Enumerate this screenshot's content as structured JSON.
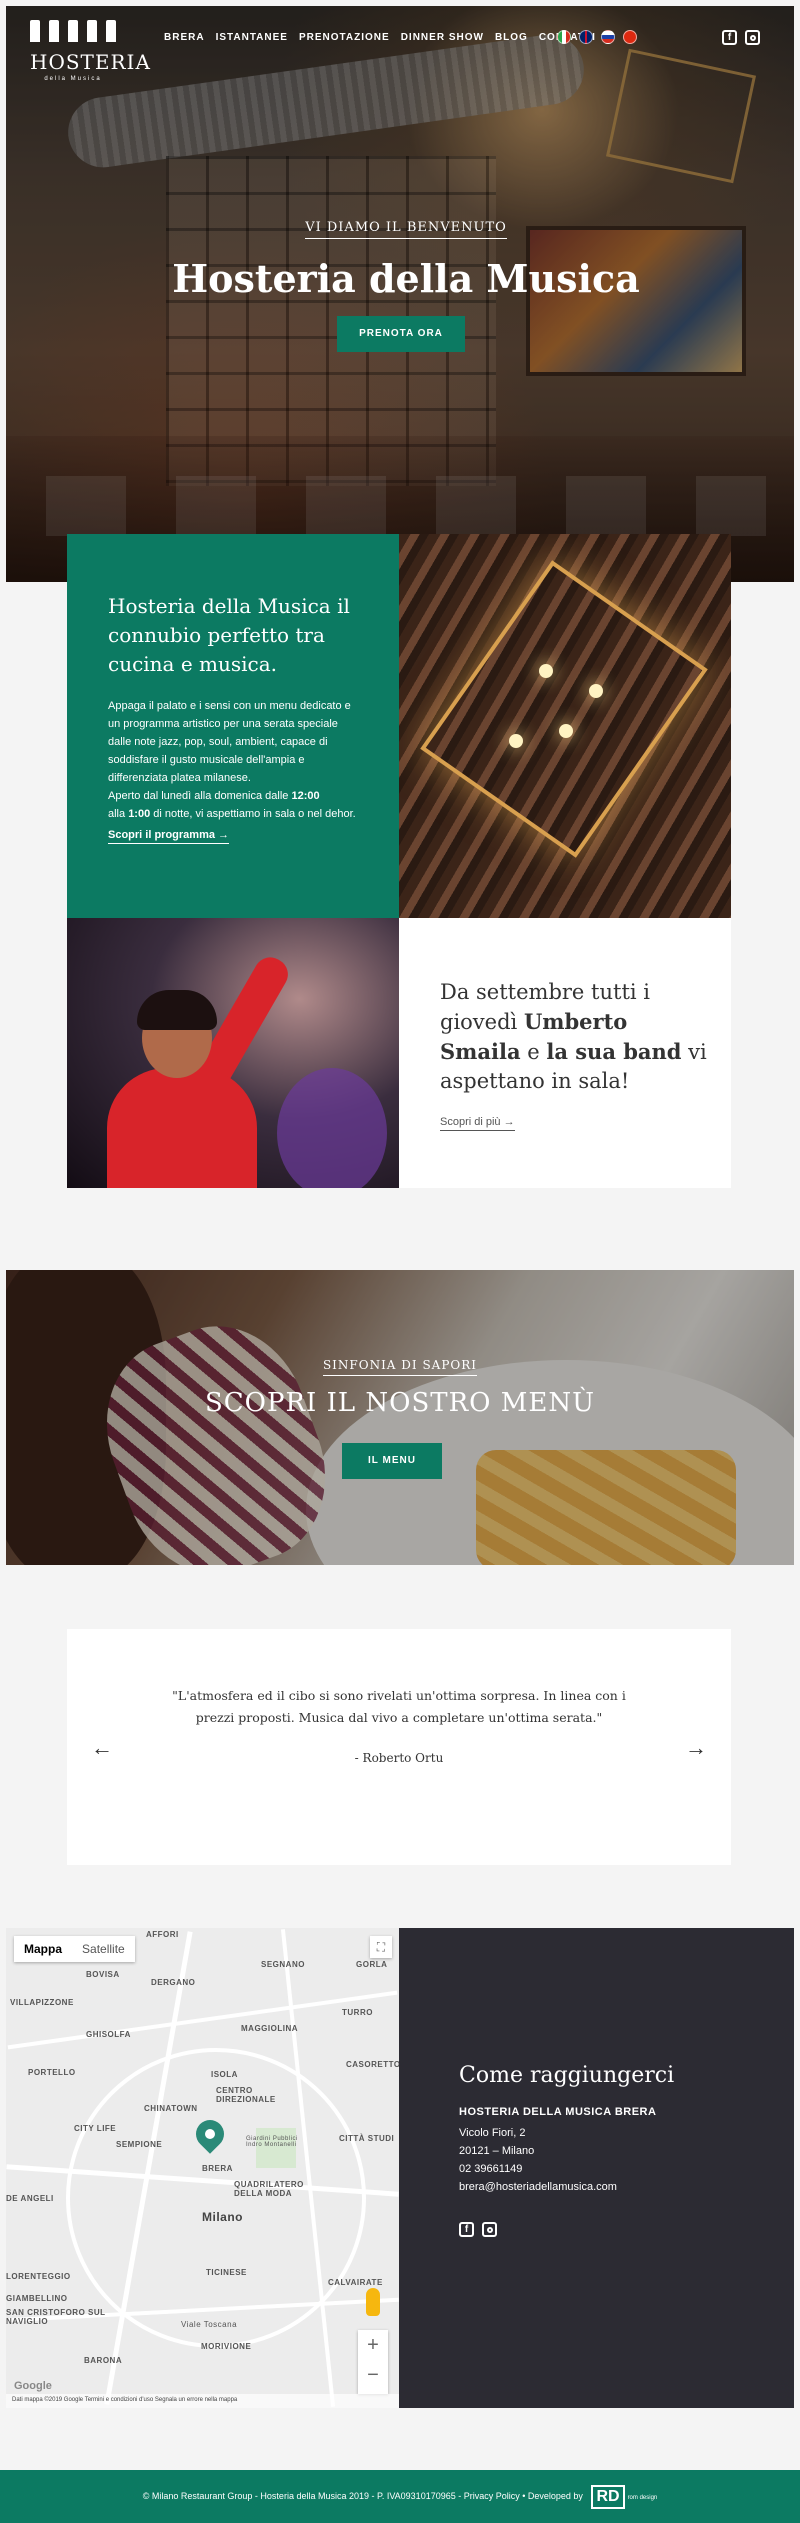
{
  "header": {
    "logo": {
      "word": "HOSTERIA",
      "sub": "della Musica"
    },
    "nav": [
      "BRERA",
      "ISTANTANEE",
      "PRENOTAZIONE",
      "DINNER SHOW",
      "BLOG",
      "CONTATTI"
    ],
    "flags": [
      {
        "name": "italian-flag-icon",
        "color": "#2aa44a"
      },
      {
        "name": "uk-flag-icon",
        "color": "#c8102e"
      },
      {
        "name": "russian-flag-icon",
        "color": "#1c3fa6"
      },
      {
        "name": "chinese-flag-icon",
        "color": "#de2910"
      }
    ],
    "social": {
      "facebook": "f"
    }
  },
  "hero": {
    "kicker": "VI DIAMO IL BENVENUTO",
    "title": "Hosteria della Musica",
    "cta": "PRENOTA ORA"
  },
  "intro": {
    "title": "Hosteria della Musica il connubio perfetto tra cucina e musica.",
    "body": "Appaga il palato e i sensi con un menu dedicato e un programma artistico per una serata speciale dalle note jazz, pop, soul, ambient, capace di soddisfare il gusto musicale dell'ampia e differenziata platea milanese.",
    "hours_pre": "Aperto dal lunedì alla domenica dalle ",
    "hours_open": "12:00",
    "hours_mid": " alla ",
    "hours_close": "1:00",
    "hours_post": " di notte, vi aspettiamo in sala o nel dehor.",
    "link": "Scopri il programma →"
  },
  "news": {
    "pre": "Da settembre tutti i giovedì ",
    "name": "Umberto Smaila",
    "mid": " e ",
    "band": "la sua band",
    "post": " vi aspettano in sala!",
    "link": "Scopri di più →"
  },
  "menu": {
    "kicker": "SINFONIA DI SAPORI",
    "title": "SCOPRI IL NOSTRO MENÙ",
    "cta": "IL MENU"
  },
  "testimonial": {
    "quote": "\"L'atmosfera ed il cibo si sono rivelati un'ottima sorpresa. In linea con i prezzi proposti. Musica dal vivo a completare un'ottima serata.\"",
    "author": "- Roberto Ortu",
    "prev": "←",
    "next": "→"
  },
  "map": {
    "tab_map": "Mappa",
    "tab_satellite": "Satellite",
    "zoom_in": "+",
    "zoom_out": "−",
    "fullscreen": "⛶",
    "google": "Google",
    "footer": "Dati mappa ©2019 Google   Termini e condizioni d'uso   Segnala un errore nella mappa",
    "labels": [
      "AFFORI",
      "SEGNANO",
      "GORLA",
      "BOVISA",
      "DERGANO",
      "VILLAPIZZONE",
      "TURRO",
      "GHISOLFA",
      "MAGGIOLINA",
      "PORTELLO",
      "ISOLA",
      "CASORETTO",
      "CENTRO DIREZIONALE",
      "CHINATOWN",
      "CITY LIFE",
      "SEMPIONE",
      "BRERA",
      "CITTÀ STUDI",
      "QUADRILATERO DELLA MODA",
      "Giardini Pubblici Indro Montanelli",
      "DE ANGELI",
      "TICINESE",
      "CALVAIRATE",
      "GIAMBELLINO",
      "SAN CRISTOFORO SUL NAVIGLIO",
      "BARONA",
      "MORIVIONE",
      "LORENTEGGIO",
      "Viale Toscana"
    ],
    "city": "Milano"
  },
  "contact": {
    "title": "Come raggiungerci",
    "name": "HOSTERIA DELLA MUSICA BRERA",
    "street": "Vicolo Fiori, 2",
    "city": "20121 – Milano",
    "phone": "02 39661149",
    "email": "brera@hosteriadellamusica.com"
  },
  "footer": {
    "text": "© Milano Restaurant Group - Hosteria della Musica 2019 - P. IVA09310170965 - Privacy Policy • Developed by",
    "brand": "RD",
    "brand_sub": "rom design"
  }
}
